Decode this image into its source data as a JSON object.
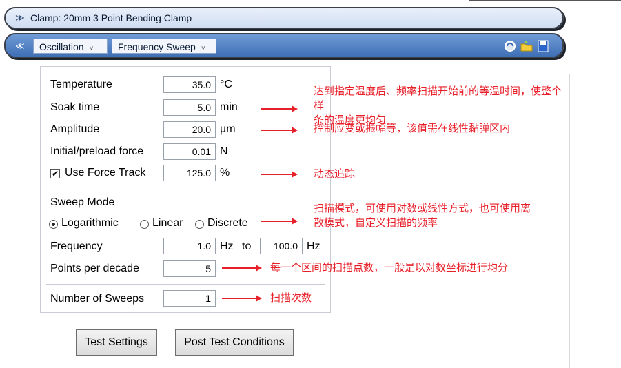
{
  "clamp_bar": {
    "label": "Clamp: 20mm 3 Point Bending Clamp",
    "icon": "chevron-double-down"
  },
  "mode_bar": {
    "icon": "chevron-double-up",
    "test_type": "Oscillation",
    "test_mode": "Frequency Sweep",
    "dropdown_arrow": "˅",
    "toolbar_icons": [
      "refresh-icon",
      "open-folder-icon",
      "save-icon"
    ]
  },
  "form": {
    "temperature": {
      "label": "Temperature",
      "value": "35.0",
      "unit": "°C"
    },
    "soak_time": {
      "label": "Soak time",
      "value": "5.0",
      "unit": "min"
    },
    "amplitude": {
      "label": "Amplitude",
      "value": "20.0",
      "unit": "µm"
    },
    "preload_force": {
      "label": "Initial/preload force",
      "value": "0.01",
      "unit": "N"
    },
    "force_track": {
      "label": "Use Force Track",
      "checked": true,
      "value": "125.0",
      "unit": "%"
    },
    "sweep_mode": {
      "label": "Sweep Mode",
      "selected": "Logarithmic",
      "options": [
        "Logarithmic",
        "Linear",
        "Discrete"
      ]
    },
    "frequency": {
      "label": "Frequency",
      "from": "1.0",
      "from_unit": "Hz",
      "to_label": "to",
      "to": "100.0",
      "to_unit": "Hz"
    },
    "points_per_decade": {
      "label": "Points per decade",
      "value": "5"
    },
    "number_of_sweeps": {
      "label": "Number of Sweeps",
      "value": "1"
    }
  },
  "buttons": {
    "test_settings": "Test Settings",
    "post_test": "Post Test Conditions"
  },
  "annotations": {
    "soak": [
      "达到指定温度后、频率扫描开始前的等温时间，使整个样",
      "条的温度更均匀"
    ],
    "amplitude": "控制应变或振幅等，该值需在线性黏弹区内",
    "force_track": "动态追踪",
    "sweep_mode": [
      "扫描模式，可使用对数或线性方式，也可使用离",
      "散模式，自定义扫描的频率"
    ],
    "points": "每一个区间的扫描点数，一般是以对数坐标进行均分",
    "sweeps": "扫描次数"
  },
  "colors": {
    "annotation": "#e8202a",
    "bar_blue": "#3f6fb6",
    "bar_light": "#dfe8f7"
  }
}
